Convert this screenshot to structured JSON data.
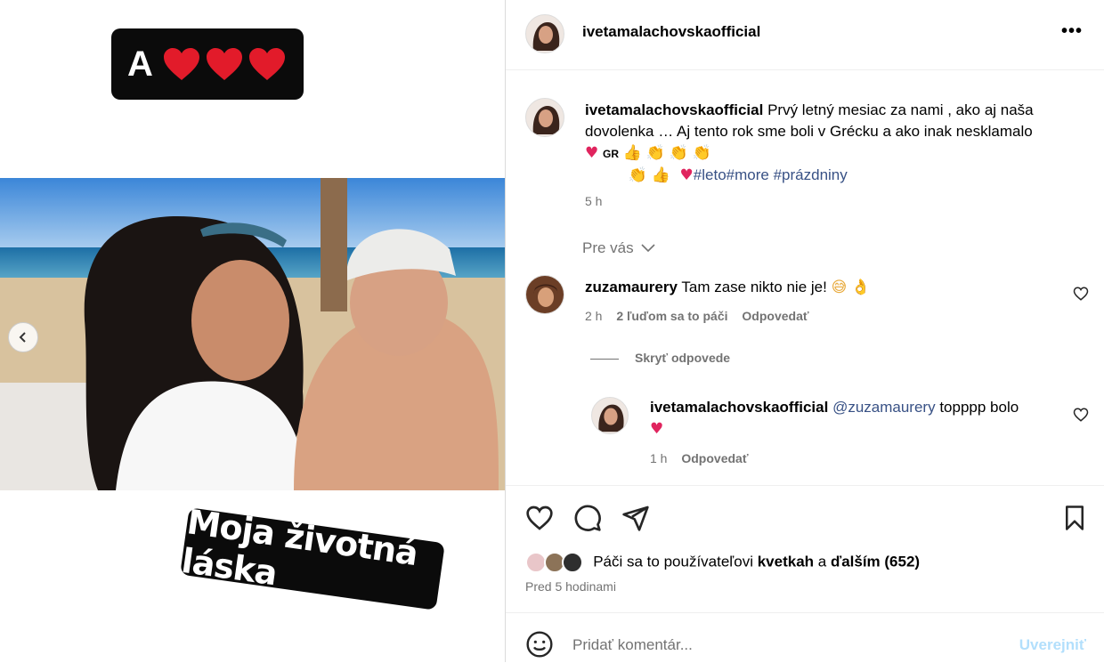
{
  "media": {
    "sticker_top": {
      "letter": "A"
    },
    "sticker_bottom": {
      "text": "Moja životná láska"
    }
  },
  "header": {
    "username": "ivetamalachovskaofficial",
    "more": "•••"
  },
  "caption": {
    "username": "ivetamalachovskaofficial",
    "text": "Prvý letný mesiac za nami , ako aj naša dovolenka … Aj tento rok sme boli v Grécku a ako inak nesklamalo",
    "emoji_line1": "GR",
    "hashtags": [
      "#leto",
      "#more",
      "#prázdniny"
    ],
    "time": "5 h"
  },
  "for_you": "Pre vás",
  "comments": [
    {
      "username": "zuzamaurery",
      "text": "Tam zase nikto nie je!",
      "time": "2 h",
      "likes": "2 ľuďom sa to páči",
      "reply": "Odpovedať"
    }
  ],
  "hide_replies": "Skryť odpovede",
  "reply": {
    "username": "ivetamalachovskaofficial",
    "mention": "@zuzamaurery",
    "text": "topppp bolo",
    "time": "1 h",
    "reply_label": "Odpovedať"
  },
  "likes_line": {
    "prefix": "Páči sa to používateľovi",
    "user": "kvetkah",
    "joiner": "a",
    "others": "ďalším (652)"
  },
  "posted": "Pred 5 hodinami",
  "composer": {
    "placeholder": "Pridať komentár...",
    "post": "Uverejniť"
  },
  "colors": {
    "link": "#385185",
    "muted": "#737373",
    "post_disabled": "#b2dffc",
    "heart": "#e0245e"
  }
}
